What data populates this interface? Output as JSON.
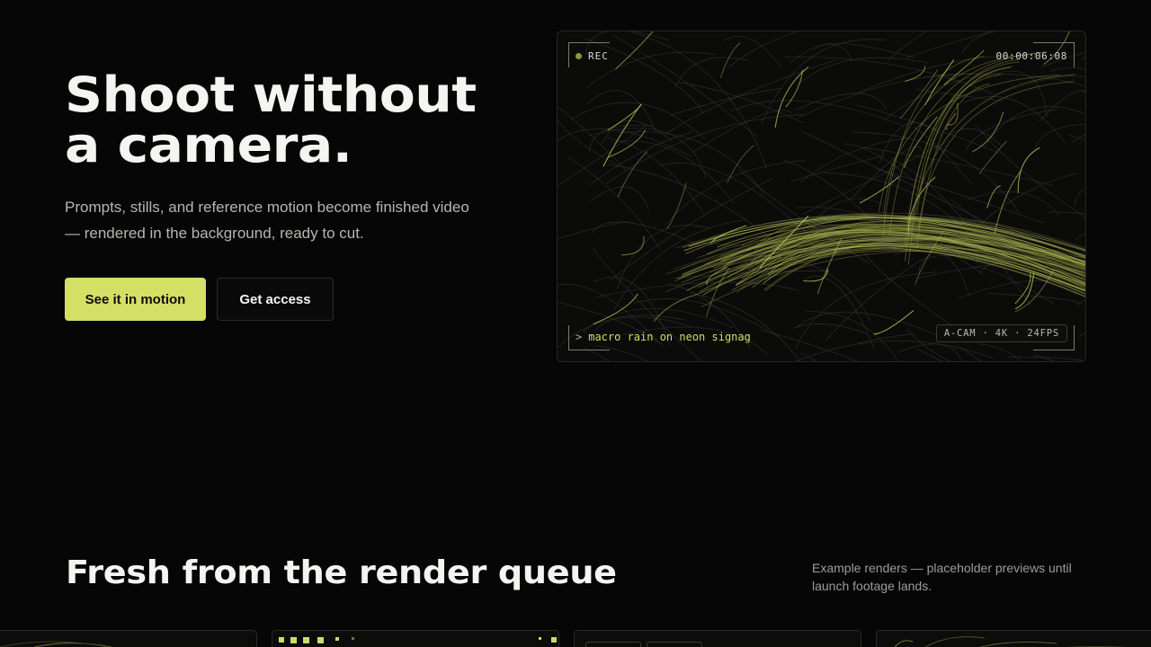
{
  "hero": {
    "title_line1": "Shoot without",
    "title_line2": "a camera.",
    "subtitle": "Prompts, stills, and reference motion become finished video — rendered in the background, ready to cut.",
    "primary_cta": "See it in motion",
    "secondary_cta": "Get access"
  },
  "viewer": {
    "rec_label": "REC",
    "timecode": "00:00:06:08",
    "prompt_caret": ">",
    "prompt_text": "macro rain on neon signag",
    "spec_badge": "A-CAM · 4K · 24FPS"
  },
  "queue": {
    "title": "Fresh from the render queue",
    "note": "Example renders — placeholder previews until launch footage lands."
  },
  "colors": {
    "accent": "#d4df66",
    "background": "#060606",
    "rec_dot": "#8a9a3a"
  }
}
